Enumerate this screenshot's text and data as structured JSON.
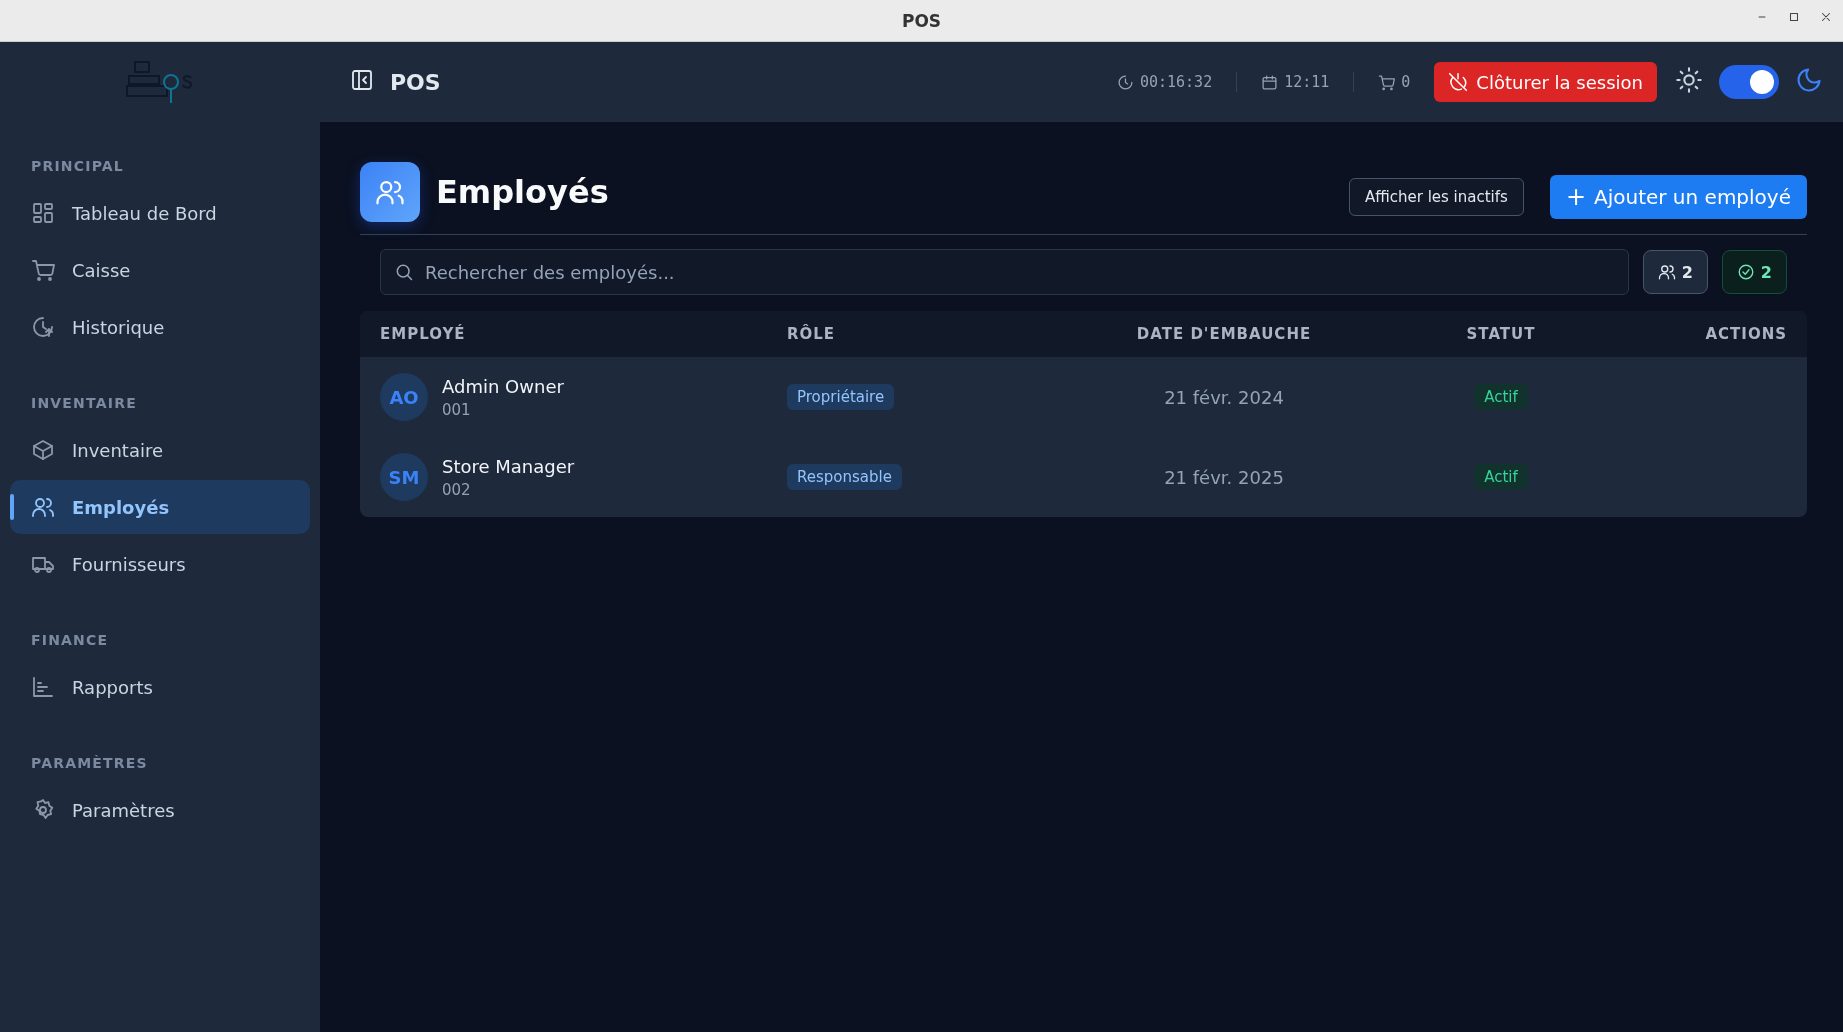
{
  "window": {
    "title": "POS"
  },
  "sidebar": {
    "sections": [
      {
        "title": "PRINCIPAL",
        "items": [
          {
            "label": "Tableau de Bord",
            "selected": false
          },
          {
            "label": "Caisse",
            "selected": false
          },
          {
            "label": "Historique",
            "selected": false
          }
        ]
      },
      {
        "title": "INVENTAIRE",
        "items": [
          {
            "label": "Inventaire",
            "selected": false
          },
          {
            "label": "Employés",
            "selected": true
          },
          {
            "label": "Fournisseurs",
            "selected": false
          }
        ]
      },
      {
        "title": "FINANCE",
        "items": [
          {
            "label": "Rapports",
            "selected": false
          }
        ]
      },
      {
        "title": "PARAMÈTRES",
        "items": [
          {
            "label": "Paramètres",
            "selected": false
          }
        ]
      }
    ]
  },
  "topbar": {
    "title": "POS",
    "timer": "00:16:32",
    "clock": "12:11",
    "cart_count": "0",
    "close_session": "Clôturer la session",
    "dark_mode": true
  },
  "page": {
    "title": "Employés",
    "show_inactive": "Afficher les inactifs",
    "add_button": "Ajouter un employé",
    "add_icon": "+",
    "search": {
      "placeholder": "Rechercher des employés..."
    },
    "total_count": "2",
    "active_count": "2"
  },
  "table": {
    "columns": [
      "EMPLOYÉ",
      "RÔLE",
      "DATE D'EMBAUCHE",
      "STATUT",
      "ACTIONS"
    ],
    "rows": [
      {
        "initials": "AO",
        "name": "Admin Owner",
        "code": "001",
        "role": "Propriétaire",
        "hired": "21 févr. 2024",
        "status": "Actif"
      },
      {
        "initials": "SM",
        "name": "Store Manager",
        "code": "002",
        "role": "Responsable",
        "hired": "21 févr. 2025",
        "status": "Actif"
      }
    ]
  }
}
